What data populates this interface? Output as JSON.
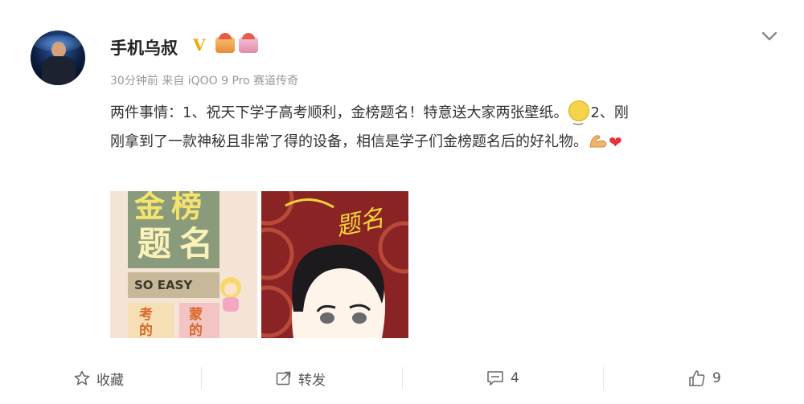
{
  "post": {
    "username": "手机乌叔",
    "verified_badge": "V",
    "meta": "30分钟前 来自 iQOO 9 Pro 赛道传奇",
    "text_line1": "两件事情：1、祝天下学子高考顺利，金榜题名！特意送大家两张壁纸。",
    "text_line1_tail": "2、刚",
    "text_line2": "刚拿到了一款神秘且非常了得的设备，相信是学子们金榜题名后的好礼物。",
    "icons": {
      "more": "chevron-down-icon",
      "emoji1": "smile-emoji-icon",
      "emoji2": "flexed-arm-emoji-icon",
      "emoji3": "red-heart-emoji-icon"
    }
  },
  "image1": {
    "top_text": "金榜",
    "big_text": "题名",
    "banner": "SO EASY",
    "tile1": "考的",
    "tile2": "蒙的"
  },
  "image2": {
    "handwriting": "题名"
  },
  "actions": {
    "favorite_label": "收藏",
    "repost_label": "转发",
    "comment_count": "4",
    "like_count": "9"
  },
  "colors": {
    "username": "#222222",
    "meta": "#999999",
    "badge": "#f2a900",
    "image1_block": "#8a9b7c",
    "image2_bg": "#8a2424",
    "accent_yellow": "#f3d43a"
  }
}
